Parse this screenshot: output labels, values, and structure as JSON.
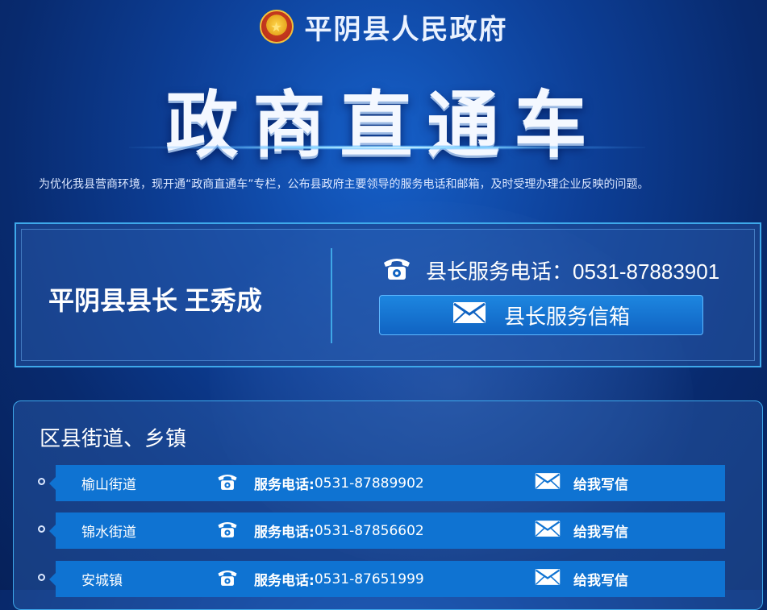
{
  "header": {
    "emblem_icon": "national-emblem-icon",
    "gov_name": "平阴县人民政府",
    "title": "政商直通车",
    "intro": "为优化我县营商环境，现开通“政商直通车”专栏，公布县政府主要领导的服务电话和邮箱，及时受理办理企业反映的问题。"
  },
  "leader": {
    "name": "平阴县县长 王秀成",
    "phone_text": "县长服务电话：0531-87883901",
    "phone_icon": "telephone-icon",
    "mail_label": "县长服务信箱",
    "mail_icon": "envelope-icon"
  },
  "districts": {
    "title": "区县街道、乡镇",
    "phone_label": "服务电话:",
    "mail_label": "给我写信",
    "items": [
      {
        "name": "榆山街道",
        "phone": "0531-87889902"
      },
      {
        "name": "锦水街道",
        "phone": "0531-87856602"
      },
      {
        "name": "安城镇",
        "phone": "0531-87651999"
      }
    ]
  },
  "colors": {
    "background": "#0d3f97",
    "row": "#0f73d2",
    "border": "#3ea8ea"
  }
}
